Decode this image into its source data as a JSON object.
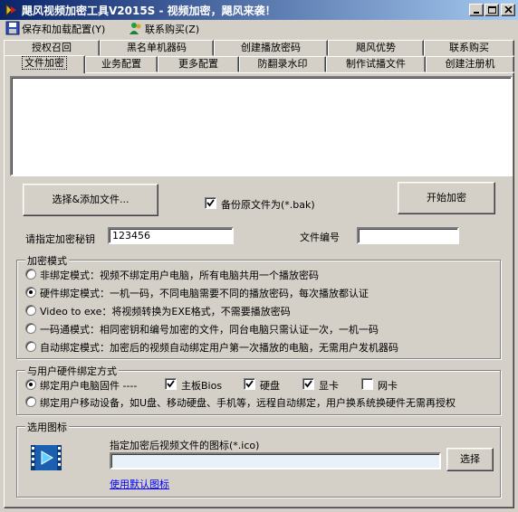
{
  "window": {
    "title": "飓风视频加密工具V2015S - 视频加密，飓风来袭！"
  },
  "menu": [
    {
      "label": "保存和加载配置(Y)",
      "icon": "save-icon"
    },
    {
      "label": "联系购买(Z)",
      "icon": "contact-icon"
    }
  ],
  "tabs_row1": [
    "授权召回",
    "黑名单机器码",
    "创建播放密码",
    "飓风优势",
    "联系购买"
  ],
  "tabs_row2": [
    "文件加密",
    "业务配置",
    "更多配置",
    "防翻录水印",
    "制作试播文件",
    "创建注册机"
  ],
  "active_tab": "文件加密",
  "buttons": {
    "select_files": "选择&添加文件...",
    "start_encrypt": "开始加密",
    "choose_icon": "选择"
  },
  "backup": {
    "label": "备份原文件为(*.bak)",
    "checked": true
  },
  "key": {
    "label": "请指定加密秘钥",
    "value": "123456"
  },
  "file_no": {
    "label": "文件编号",
    "value": ""
  },
  "encrypt_mode": {
    "legend": "加密模式",
    "options": [
      {
        "label": "非绑定模式：视频不绑定用户电脑，所有电脑共用一个播放密码",
        "selected": false
      },
      {
        "label": "硬件绑定模式：一机一码，不同电脑需要不同的播放密码，每次播放都认证",
        "selected": true
      },
      {
        "label": "Video to exe：将视频转换为EXE格式，不需要播放密码",
        "selected": false
      },
      {
        "label": "一码通模式：相同密钥和编号加密的文件，同台电脑只需认证一次，一机一码",
        "selected": false
      },
      {
        "label": "自动绑定模式：加密后的视频自动绑定用户第一次播放的电脑，无需用户发机器码",
        "selected": false
      }
    ]
  },
  "hardware": {
    "legend": "与用户硬件绑定方式",
    "opt1": {
      "label": "绑定用户电脑固件 ----",
      "selected": true
    },
    "checks": [
      {
        "label": "主板Bios",
        "checked": true
      },
      {
        "label": "硬盘",
        "checked": true
      },
      {
        "label": "显卡",
        "checked": true
      },
      {
        "label": "网卡",
        "checked": false
      }
    ],
    "opt2": {
      "label": "绑定用户移动设备，如U盘、移动硬盘、手机等，远程自动绑定，用户换系统换硬件无需再授权",
      "selected": false
    }
  },
  "icon_section": {
    "legend": "选用图标",
    "label": "指定加密后视频文件的图标(*.ico)",
    "path": "",
    "default_link": "使用默认图标",
    "preview_icon": "video-play-icon"
  },
  "colors": {
    "title_start": "#0a246a",
    "title_end": "#a6caf0",
    "face": "#d4d0c8",
    "link": "#0000ff"
  }
}
